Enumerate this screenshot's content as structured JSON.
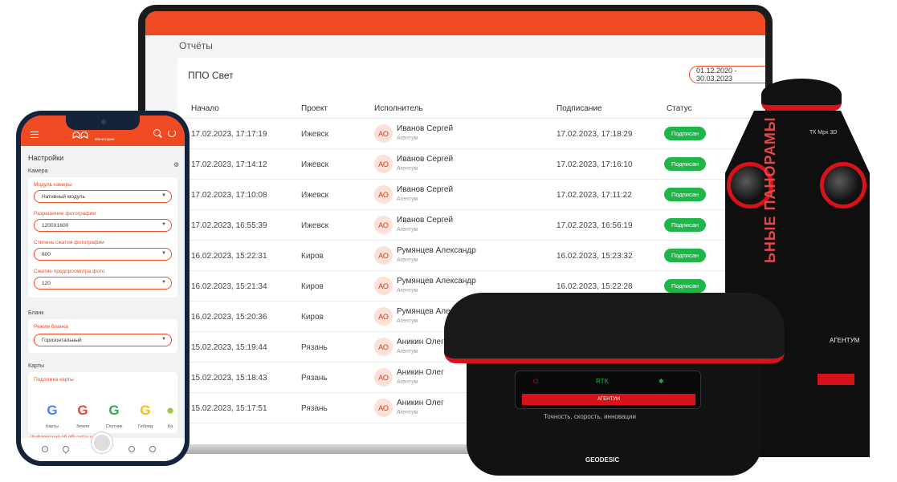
{
  "laptop": {
    "page_title": "Отчёты",
    "report_title": "ППО Свет",
    "date_range": "01.12.2020 - 30.03.2023",
    "columns": [
      "Начало",
      "Проект",
      "Исполнитель",
      "Подписание",
      "Статус"
    ],
    "rows": [
      {
        "start": "17.02.2023, 17:17:19",
        "project": "Ижевск",
        "initials": "АО",
        "name": "Иванов Сергей",
        "org": "Агентум",
        "signed": "17.02.2023, 17:18:29",
        "status": "Подписан"
      },
      {
        "start": "17.02.2023, 17:14:12",
        "project": "Ижевск",
        "initials": "АО",
        "name": "Иванов Сергей",
        "org": "Агентум",
        "signed": "17.02.2023, 17:16:10",
        "status": "Подписан"
      },
      {
        "start": "17.02.2023, 17:10:08",
        "project": "Ижевск",
        "initials": "АО",
        "name": "Иванов Сергей",
        "org": "Агентум",
        "signed": "17.02.2023, 17:11:22",
        "status": "Подписан"
      },
      {
        "start": "17.02.2023, 16:55:39",
        "project": "Ижевск",
        "initials": "АО",
        "name": "Иванов Сергей",
        "org": "Агентум",
        "signed": "17.02.2023, 16:56:19",
        "status": "Подписан"
      },
      {
        "start": "16.02.2023, 15:22:31",
        "project": "Киров",
        "initials": "АО",
        "name": "Румянцев Александр",
        "org": "Агентум",
        "signed": "16.02.2023, 15:23:32",
        "status": "Подписан"
      },
      {
        "start": "16.02.2023, 15:21:34",
        "project": "Киров",
        "initials": "АО",
        "name": "Румянцев Александр",
        "org": "Агентум",
        "signed": "16.02.2023, 15:22:28",
        "status": "Подписан"
      },
      {
        "start": "16.02.2023, 15:20:36",
        "project": "Киров",
        "initials": "АО",
        "name": "Румянцев Александр",
        "org": "Агентум",
        "signed": "",
        "status": ""
      },
      {
        "start": "15.02.2023, 15:19:44",
        "project": "Рязань",
        "initials": "АО",
        "name": "Аникин Олег",
        "org": "Агентум",
        "signed": "",
        "status": ""
      },
      {
        "start": "15.02.2023, 15:18:43",
        "project": "Рязань",
        "initials": "АО",
        "name": "Аникин Олег",
        "org": "Агентум",
        "signed": "",
        "status": ""
      },
      {
        "start": "15.02.2023, 15:17:51",
        "project": "Рязань",
        "initials": "АО",
        "name": "Аникин Олег",
        "org": "Агентум",
        "signed": "",
        "status": ""
      }
    ],
    "accent": "#f04a23",
    "status_color": "#1fb548"
  },
  "phone": {
    "app_name": "ᗣᗣ",
    "app_sub": "Мониторинг",
    "title": "Настройки",
    "sections": {
      "camera": "Камера",
      "blank": "Бланк",
      "maps": "Карты"
    },
    "fields": {
      "camera_module_label": "Модуль камеры",
      "camera_module_value": "Нативный модуль",
      "resolution_label": "Разрешение фотографии",
      "resolution_value": "1200Х1600",
      "compression_label": "Степень сжатия фотографии",
      "compression_value": "800",
      "preview_label": "Сжатие предпросмотра фото",
      "preview_value": "120",
      "blank_mode_label": "Режим бланка",
      "blank_mode_value": "Горизонтальный",
      "map_layer_label": "Подложка карты"
    },
    "maps": [
      "Карты",
      "Земля",
      "Спутник",
      "Гибрид",
      "Ка"
    ],
    "info_label": "Информация об объектах на карте"
  },
  "devices": {
    "camera_model": "ТК Мрх 3D",
    "camera_vertical": "ЬНЫЕ ПАНОРАМЫ",
    "camera_brand": "АГЕНТУМ",
    "gnss_led_rtk": "RTK",
    "gnss_strip": "АГЕНТУМ",
    "gnss_slogan": "Точность, скорость, инновации",
    "gnss_brand": "GEODESIC"
  }
}
